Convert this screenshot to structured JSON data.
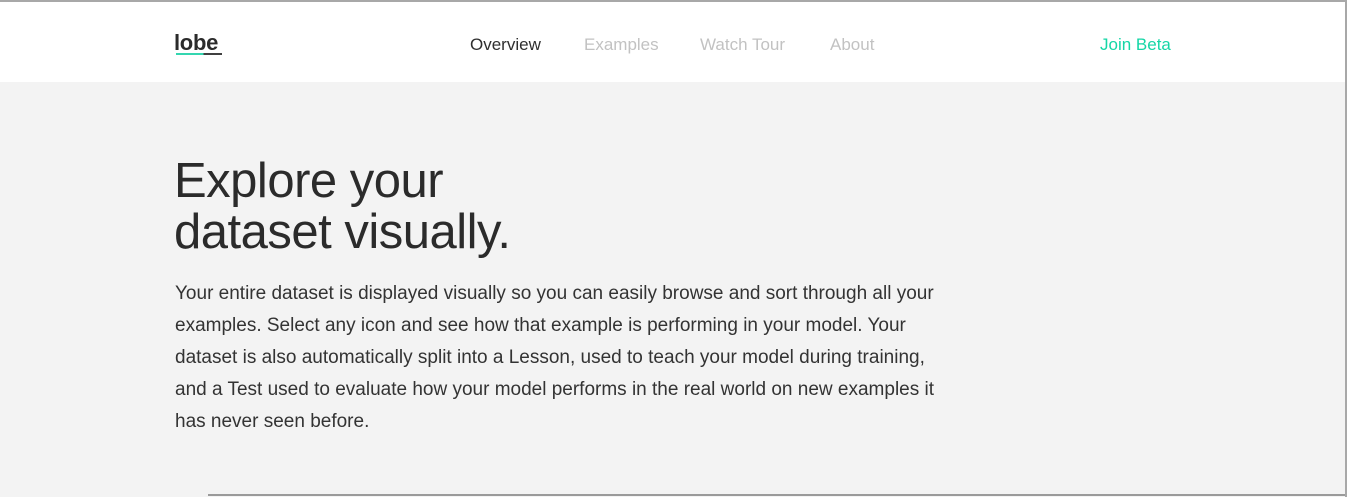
{
  "header": {
    "logo": "lobe",
    "nav": [
      {
        "label": "Overview",
        "active": true
      },
      {
        "label": "Examples",
        "active": false
      },
      {
        "label": "Watch Tour",
        "active": false
      },
      {
        "label": "About",
        "active": false
      }
    ],
    "cta_label": "Join Beta"
  },
  "hero": {
    "title_line1": "Explore your",
    "title_line2": "dataset visually.",
    "body": "Your entire dataset is displayed visually so you can easily browse and sort through all your examples. Select any icon and see how that example is performing in your model. Your dataset is also automatically split into a Lesson, used to teach your model during training, and a Test used to evaluate how your model performs in the real world on new examples it has never seen before."
  },
  "colors": {
    "accent": "#15d6a6",
    "text_dark": "#2b2b2b",
    "nav_muted": "#c2c2c2",
    "page_bg": "#f3f3f3",
    "header_bg": "#ffffff"
  }
}
